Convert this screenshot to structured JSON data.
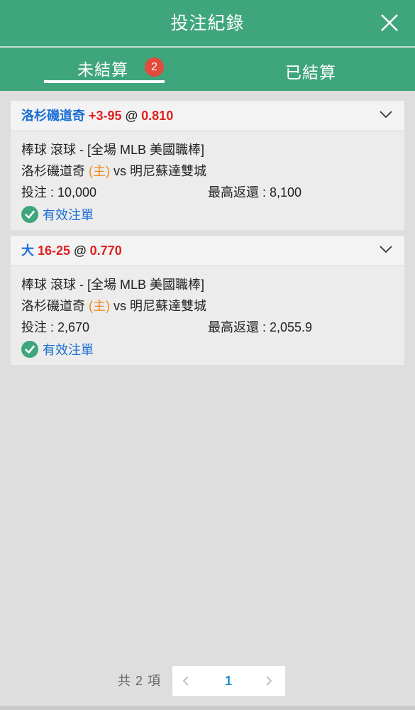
{
  "header": {
    "title": "投注紀錄"
  },
  "tabs": [
    {
      "label": "未結算",
      "badge": "2"
    },
    {
      "label": "已結算"
    }
  ],
  "bets": [
    {
      "selection": "洛杉磯道奇",
      "line": "+3-95",
      "at": "@",
      "odds": "0.810",
      "sport": "棒球 滾球 - [全場 MLB 美國職棒]",
      "home_team": "洛杉磯道奇",
      "home_tag": "(主)",
      "vs": "vs",
      "away_team": "明尼蘇達雙城",
      "stake": "投注 : 10,000",
      "max_return": "最高返還 : 8,100",
      "status": "有效注單"
    },
    {
      "selection": "大",
      "line": "16-25",
      "at": "@",
      "odds": "0.770",
      "sport": "棒球 滾球 - [全場 MLB 美國職棒]",
      "home_team": "洛杉磯道奇",
      "home_tag": "(主)",
      "vs": "vs",
      "away_team": "明尼蘇達雙城",
      "stake": "投注 : 2,670",
      "max_return": "最高返還 : 2,055.9",
      "status": "有效注單"
    }
  ],
  "pagination": {
    "total": "共 2 項",
    "current_page": "1"
  },
  "colors": {
    "header_bg": "#3fa57d",
    "badge": "#e24b3b",
    "selection_blue": "#1a6fd6",
    "odds_red": "#e02020",
    "home_tag_orange": "#f08c1e",
    "status_check_green": "#3fa57d",
    "page_background": "#dedede"
  },
  "icons": {
    "close": "close-icon",
    "expand": "chevron-down-icon",
    "valid": "check-circle-icon",
    "prev": "chevron-left-icon",
    "next": "chevron-right-icon"
  }
}
